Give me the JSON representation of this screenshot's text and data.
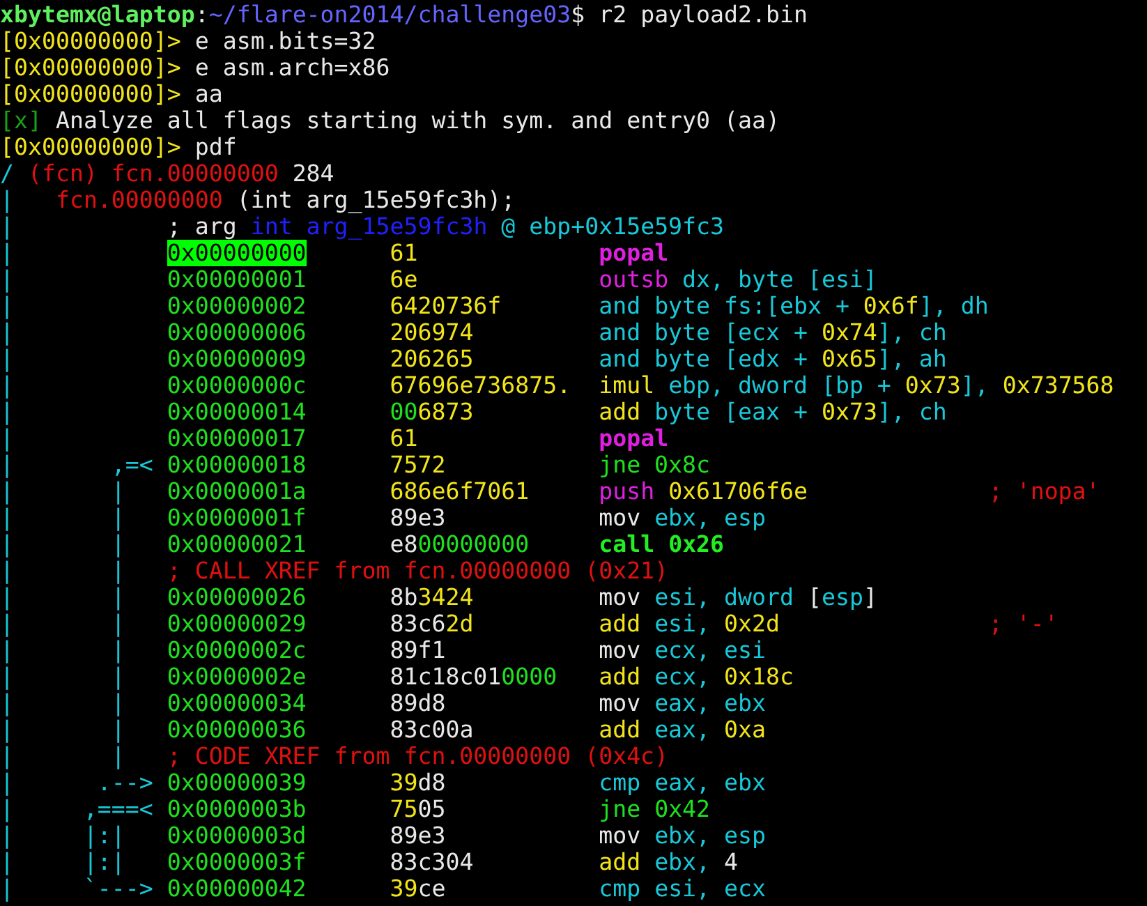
{
  "terminal": {
    "lines": [
      {
        "segments": [
          {
            "text": "xbytemx@laptop",
            "color": "#5ef05e",
            "kind": "bold"
          },
          {
            "text": ":",
            "color": "#e8e8e8",
            "kind": "normal"
          },
          {
            "text": "~/flare-on2014/challenge03",
            "color": "#6464ff",
            "kind": "normal"
          },
          {
            "text": "$ r2 payload2.bin",
            "color": "#e8e8e8",
            "kind": "normal"
          }
        ]
      },
      {
        "segments": [
          {
            "text": "[0x00000000]>",
            "color": "#f2e41a",
            "kind": "normal"
          },
          {
            "text": " e asm.bits=32",
            "color": "#e8e8e8",
            "kind": "normal"
          }
        ]
      },
      {
        "segments": [
          {
            "text": "[0x00000000]>",
            "color": "#f2e41a",
            "kind": "normal"
          },
          {
            "text": " e asm.arch=x86",
            "color": "#e8e8e8",
            "kind": "normal"
          }
        ]
      },
      {
        "segments": [
          {
            "text": "[0x00000000]>",
            "color": "#f2e41a",
            "kind": "normal"
          },
          {
            "text": " aa",
            "color": "#e8e8e8",
            "kind": "normal"
          }
        ]
      },
      {
        "segments": [
          {
            "text": "[x]",
            "color": "#18a018",
            "kind": "normal"
          },
          {
            "text": " Analyze all flags starting with sym. and entry0 (aa)",
            "color": "#e8e8e8",
            "kind": "normal"
          }
        ]
      },
      {
        "segments": [
          {
            "text": "[0x00000000]>",
            "color": "#f2e41a",
            "kind": "normal"
          },
          {
            "text": " pdf",
            "color": "#e8e8e8",
            "kind": "normal"
          }
        ]
      },
      {
        "segments": [
          {
            "text": "/",
            "color": "#18c8d8",
            "kind": "normal"
          },
          {
            "text": " (fcn) fcn.00000000",
            "color": "#e01010",
            "kind": "normal"
          },
          {
            "text": " 284",
            "color": "#e8e8e8",
            "kind": "normal"
          }
        ]
      },
      {
        "segments": [
          {
            "text": "|",
            "color": "#18c8d8",
            "kind": "normal"
          },
          {
            "text": "   fcn.00000000",
            "color": "#e01010",
            "kind": "normal"
          },
          {
            "text": " (int arg_15e59fc3h);",
            "color": "#e8e8e8",
            "kind": "normal"
          }
        ]
      },
      {
        "segments": [
          {
            "text": "|",
            "color": "#18c8d8",
            "kind": "normal"
          },
          {
            "text": "           ; arg",
            "color": "#e8e8e8",
            "kind": "normal"
          },
          {
            "text": " int arg_15e59fc3h",
            "color": "#2020ff",
            "kind": "normal"
          },
          {
            "text": " @ ebp+0x15e59fc3",
            "color": "#18c8d8",
            "kind": "normal"
          }
        ]
      },
      {
        "segments": [
          {
            "text": "|           ",
            "color": "#18c8d8",
            "kind": "normal"
          },
          {
            "text": "0x00000000",
            "color": "#00ff00",
            "kind": "highlight"
          },
          {
            "text": "      61",
            "color": "#f2e41a",
            "kind": "normal"
          },
          {
            "text": "             popal",
            "color": "#e020e0",
            "kind": "bold"
          }
        ]
      },
      {
        "segments": [
          {
            "text": "|           ",
            "color": "#18c8d8",
            "kind": "normal"
          },
          {
            "text": "0x00000001",
            "color": "#1ee01e",
            "kind": "normal"
          },
          {
            "text": "      6e",
            "color": "#f2e41a",
            "kind": "normal"
          },
          {
            "text": "             outsb",
            "color": "#e020e0",
            "kind": "normal"
          },
          {
            "text": " dx, byte [esi]",
            "color": "#18c8d8",
            "kind": "normal"
          }
        ]
      },
      {
        "segments": [
          {
            "text": "|           ",
            "color": "#18c8d8",
            "kind": "normal"
          },
          {
            "text": "0x00000002",
            "color": "#1ee01e",
            "kind": "normal"
          },
          {
            "text": "      6420736f",
            "color": "#f2e41a",
            "kind": "normal"
          },
          {
            "text": "       and byte fs:[ebx + ",
            "color": "#18c8d8",
            "kind": "normal"
          },
          {
            "text": "0x6f",
            "color": "#f2e41a",
            "kind": "normal"
          },
          {
            "text": "], dh",
            "color": "#18c8d8",
            "kind": "normal"
          }
        ]
      },
      {
        "segments": [
          {
            "text": "|           ",
            "color": "#18c8d8",
            "kind": "normal"
          },
          {
            "text": "0x00000006",
            "color": "#1ee01e",
            "kind": "normal"
          },
          {
            "text": "      206974",
            "color": "#f2e41a",
            "kind": "normal"
          },
          {
            "text": "         and byte [ecx + ",
            "color": "#18c8d8",
            "kind": "normal"
          },
          {
            "text": "0x74",
            "color": "#f2e41a",
            "kind": "normal"
          },
          {
            "text": "], ch",
            "color": "#18c8d8",
            "kind": "normal"
          }
        ]
      },
      {
        "segments": [
          {
            "text": "|           ",
            "color": "#18c8d8",
            "kind": "normal"
          },
          {
            "text": "0x00000009",
            "color": "#1ee01e",
            "kind": "normal"
          },
          {
            "text": "      206265",
            "color": "#f2e41a",
            "kind": "normal"
          },
          {
            "text": "         and byte [edx + ",
            "color": "#18c8d8",
            "kind": "normal"
          },
          {
            "text": "0x65",
            "color": "#f2e41a",
            "kind": "normal"
          },
          {
            "text": "], ah",
            "color": "#18c8d8",
            "kind": "normal"
          }
        ]
      },
      {
        "segments": [
          {
            "text": "|           ",
            "color": "#18c8d8",
            "kind": "normal"
          },
          {
            "text": "0x0000000c",
            "color": "#1ee01e",
            "kind": "normal"
          },
          {
            "text": "      67696e736875.",
            "color": "#f2e41a",
            "kind": "normal"
          },
          {
            "text": "  imul",
            "color": "#f2e41a",
            "kind": "normal"
          },
          {
            "text": " ebp, dword [bp + ",
            "color": "#18c8d8",
            "kind": "normal"
          },
          {
            "text": "0x73",
            "color": "#f2e41a",
            "kind": "normal"
          },
          {
            "text": "], ",
            "color": "#18c8d8",
            "kind": "normal"
          },
          {
            "text": "0x737568",
            "color": "#f2e41a",
            "kind": "normal"
          }
        ]
      },
      {
        "segments": [
          {
            "text": "|           ",
            "color": "#18c8d8",
            "kind": "normal"
          },
          {
            "text": "0x00000014",
            "color": "#1ee01e",
            "kind": "normal"
          },
          {
            "text": "      00",
            "color": "#1ee01e",
            "kind": "normal"
          },
          {
            "text": "6873",
            "color": "#f2e41a",
            "kind": "normal"
          },
          {
            "text": "         add",
            "color": "#f2e41a",
            "kind": "normal"
          },
          {
            "text": " byte [eax + ",
            "color": "#18c8d8",
            "kind": "normal"
          },
          {
            "text": "0x73",
            "color": "#f2e41a",
            "kind": "normal"
          },
          {
            "text": "], ch",
            "color": "#18c8d8",
            "kind": "normal"
          }
        ]
      },
      {
        "segments": [
          {
            "text": "|           ",
            "color": "#18c8d8",
            "kind": "normal"
          },
          {
            "text": "0x00000017",
            "color": "#1ee01e",
            "kind": "normal"
          },
          {
            "text": "      61",
            "color": "#f2e41a",
            "kind": "normal"
          },
          {
            "text": "             popal",
            "color": "#e020e0",
            "kind": "bold"
          }
        ]
      },
      {
        "segments": [
          {
            "text": "|       ,=< ",
            "color": "#18c8d8",
            "kind": "normal"
          },
          {
            "text": "0x00000018",
            "color": "#1ee01e",
            "kind": "normal"
          },
          {
            "text": "      7572",
            "color": "#f2e41a",
            "kind": "normal"
          },
          {
            "text": "           jne 0x8c",
            "color": "#1ee01e",
            "kind": "normal"
          }
        ]
      },
      {
        "segments": [
          {
            "text": "|       |   ",
            "color": "#18c8d8",
            "kind": "normal"
          },
          {
            "text": "0x0000001a",
            "color": "#1ee01e",
            "kind": "normal"
          },
          {
            "text": "      686e6f7061",
            "color": "#f2e41a",
            "kind": "normal"
          },
          {
            "text": "     push",
            "color": "#e020e0",
            "kind": "normal"
          },
          {
            "text": " 0x61706f6e",
            "color": "#f2e41a",
            "kind": "normal"
          },
          {
            "text": "             ; 'nopa'",
            "color": "#e01010",
            "kind": "normal"
          }
        ]
      },
      {
        "segments": [
          {
            "text": "|       |   ",
            "color": "#18c8d8",
            "kind": "normal"
          },
          {
            "text": "0x0000001f",
            "color": "#1ee01e",
            "kind": "normal"
          },
          {
            "text": "      89e3",
            "color": "#e8e8e8",
            "kind": "normal"
          },
          {
            "text": "           mov",
            "color": "#e8e8e8",
            "kind": "normal"
          },
          {
            "text": " ebx, esp",
            "color": "#18c8d8",
            "kind": "normal"
          }
        ]
      },
      {
        "segments": [
          {
            "text": "|       |   ",
            "color": "#18c8d8",
            "kind": "normal"
          },
          {
            "text": "0x00000021",
            "color": "#1ee01e",
            "kind": "normal"
          },
          {
            "text": "      e8",
            "color": "#e8e8e8",
            "kind": "normal"
          },
          {
            "text": "00000000",
            "color": "#1ee01e",
            "kind": "normal"
          },
          {
            "text": "     call 0x26",
            "color": "#22ee22",
            "kind": "bold"
          }
        ]
      },
      {
        "segments": [
          {
            "text": "|       |   ",
            "color": "#18c8d8",
            "kind": "normal"
          },
          {
            "text": "; CALL XREF from fcn.00000000 (0x21)",
            "color": "#e01010",
            "kind": "normal"
          }
        ]
      },
      {
        "segments": [
          {
            "text": "|       |   ",
            "color": "#18c8d8",
            "kind": "normal"
          },
          {
            "text": "0x00000026",
            "color": "#1ee01e",
            "kind": "normal"
          },
          {
            "text": "      8b",
            "color": "#e8e8e8",
            "kind": "normal"
          },
          {
            "text": "3424",
            "color": "#f2e41a",
            "kind": "normal"
          },
          {
            "text": "         mov",
            "color": "#e8e8e8",
            "kind": "normal"
          },
          {
            "text": " esi, dword",
            "color": "#18c8d8",
            "kind": "normal"
          },
          {
            "text": " [",
            "color": "#e8e8e8",
            "kind": "normal"
          },
          {
            "text": "esp",
            "color": "#18c8d8",
            "kind": "normal"
          },
          {
            "text": "]",
            "color": "#e8e8e8",
            "kind": "normal"
          }
        ]
      },
      {
        "segments": [
          {
            "text": "|       |   ",
            "color": "#18c8d8",
            "kind": "normal"
          },
          {
            "text": "0x00000029",
            "color": "#1ee01e",
            "kind": "normal"
          },
          {
            "text": "      83c6",
            "color": "#e8e8e8",
            "kind": "normal"
          },
          {
            "text": "2d",
            "color": "#f2e41a",
            "kind": "normal"
          },
          {
            "text": "         add",
            "color": "#f2e41a",
            "kind": "normal"
          },
          {
            "text": " esi, ",
            "color": "#18c8d8",
            "kind": "normal"
          },
          {
            "text": "0x2d",
            "color": "#f2e41a",
            "kind": "normal"
          },
          {
            "text": "               ; '-'",
            "color": "#e01010",
            "kind": "normal"
          }
        ]
      },
      {
        "segments": [
          {
            "text": "|       |   ",
            "color": "#18c8d8",
            "kind": "normal"
          },
          {
            "text": "0x0000002c",
            "color": "#1ee01e",
            "kind": "normal"
          },
          {
            "text": "      89f1",
            "color": "#e8e8e8",
            "kind": "normal"
          },
          {
            "text": "           mov",
            "color": "#e8e8e8",
            "kind": "normal"
          },
          {
            "text": " ecx, esi",
            "color": "#18c8d8",
            "kind": "normal"
          }
        ]
      },
      {
        "segments": [
          {
            "text": "|       |   ",
            "color": "#18c8d8",
            "kind": "normal"
          },
          {
            "text": "0x0000002e",
            "color": "#1ee01e",
            "kind": "normal"
          },
          {
            "text": "      81c18c01",
            "color": "#e8e8e8",
            "kind": "normal"
          },
          {
            "text": "0000",
            "color": "#1ee01e",
            "kind": "normal"
          },
          {
            "text": "   add",
            "color": "#f2e41a",
            "kind": "normal"
          },
          {
            "text": " ecx, ",
            "color": "#18c8d8",
            "kind": "normal"
          },
          {
            "text": "0x18c",
            "color": "#f2e41a",
            "kind": "normal"
          }
        ]
      },
      {
        "segments": [
          {
            "text": "|       |   ",
            "color": "#18c8d8",
            "kind": "normal"
          },
          {
            "text": "0x00000034",
            "color": "#1ee01e",
            "kind": "normal"
          },
          {
            "text": "      89d8",
            "color": "#e8e8e8",
            "kind": "normal"
          },
          {
            "text": "           mov",
            "color": "#e8e8e8",
            "kind": "normal"
          },
          {
            "text": " eax, ebx",
            "color": "#18c8d8",
            "kind": "normal"
          }
        ]
      },
      {
        "segments": [
          {
            "text": "|       |   ",
            "color": "#18c8d8",
            "kind": "normal"
          },
          {
            "text": "0x00000036",
            "color": "#1ee01e",
            "kind": "normal"
          },
          {
            "text": "      83c00a",
            "color": "#e8e8e8",
            "kind": "normal"
          },
          {
            "text": "         add",
            "color": "#f2e41a",
            "kind": "normal"
          },
          {
            "text": " eax, ",
            "color": "#18c8d8",
            "kind": "normal"
          },
          {
            "text": "0xa",
            "color": "#f2e41a",
            "kind": "normal"
          }
        ]
      },
      {
        "segments": [
          {
            "text": "|       |   ",
            "color": "#18c8d8",
            "kind": "normal"
          },
          {
            "text": "; CODE XREF from fcn.00000000 (0x4c)",
            "color": "#e01010",
            "kind": "normal"
          }
        ]
      },
      {
        "segments": [
          {
            "text": "|      .--> ",
            "color": "#18c8d8",
            "kind": "normal"
          },
          {
            "text": "0x00000039",
            "color": "#1ee01e",
            "kind": "normal"
          },
          {
            "text": "      39",
            "color": "#f2e41a",
            "kind": "normal"
          },
          {
            "text": "d8",
            "color": "#e8e8e8",
            "kind": "normal"
          },
          {
            "text": "           cmp eax, ebx",
            "color": "#18c8d8",
            "kind": "normal"
          }
        ]
      },
      {
        "segments": [
          {
            "text": "|     ,===< ",
            "color": "#18c8d8",
            "kind": "normal"
          },
          {
            "text": "0x0000003b",
            "color": "#1ee01e",
            "kind": "normal"
          },
          {
            "text": "      75",
            "color": "#f2e41a",
            "kind": "normal"
          },
          {
            "text": "05",
            "color": "#e8e8e8",
            "kind": "normal"
          },
          {
            "text": "           jne 0x42",
            "color": "#1ee01e",
            "kind": "normal"
          }
        ]
      },
      {
        "segments": [
          {
            "text": "|     |:|   ",
            "color": "#18c8d8",
            "kind": "normal"
          },
          {
            "text": "0x0000003d",
            "color": "#1ee01e",
            "kind": "normal"
          },
          {
            "text": "      89e3",
            "color": "#e8e8e8",
            "kind": "normal"
          },
          {
            "text": "           mov",
            "color": "#e8e8e8",
            "kind": "normal"
          },
          {
            "text": " ebx, esp",
            "color": "#18c8d8",
            "kind": "normal"
          }
        ]
      },
      {
        "segments": [
          {
            "text": "|     |:|   ",
            "color": "#18c8d8",
            "kind": "normal"
          },
          {
            "text": "0x0000003f",
            "color": "#1ee01e",
            "kind": "normal"
          },
          {
            "text": "      83c304",
            "color": "#e8e8e8",
            "kind": "normal"
          },
          {
            "text": "         add",
            "color": "#f2e41a",
            "kind": "normal"
          },
          {
            "text": " ebx, ",
            "color": "#18c8d8",
            "kind": "normal"
          },
          {
            "text": "4",
            "color": "#e8e8e8",
            "kind": "normal"
          }
        ]
      },
      {
        "segments": [
          {
            "text": "|     `---> ",
            "color": "#18c8d8",
            "kind": "normal"
          },
          {
            "text": "0x00000042",
            "color": "#1ee01e",
            "kind": "normal"
          },
          {
            "text": "      39",
            "color": "#f2e41a",
            "kind": "normal"
          },
          {
            "text": "ce",
            "color": "#e8e8e8",
            "kind": "normal"
          },
          {
            "text": "           cmp esi, ecx",
            "color": "#18c8d8",
            "kind": "normal"
          }
        ]
      }
    ]
  }
}
